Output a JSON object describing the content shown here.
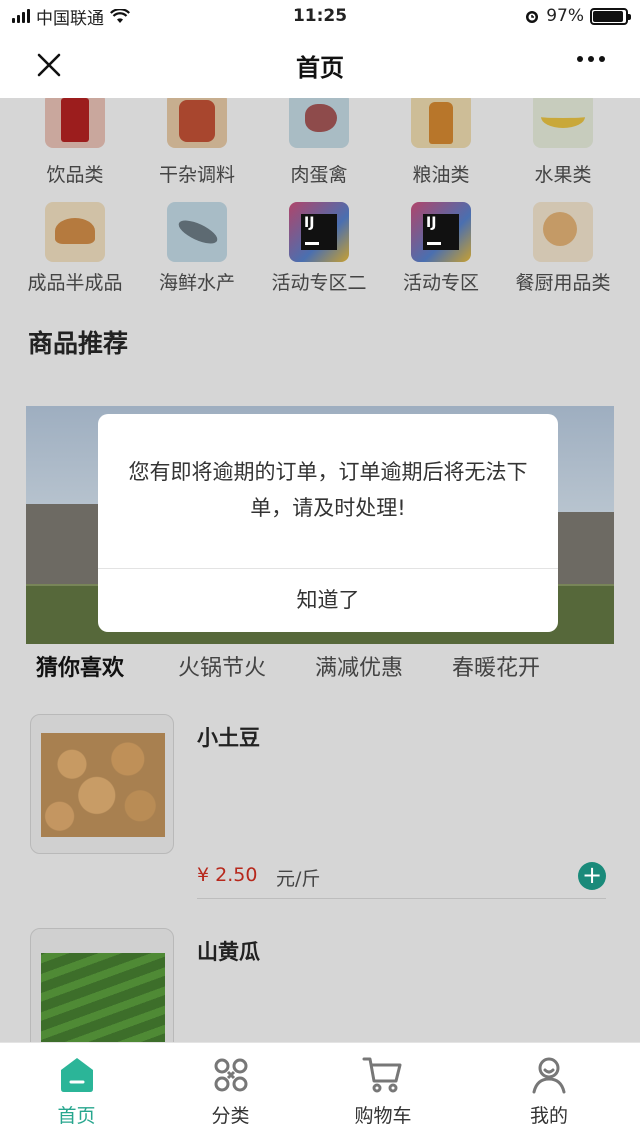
{
  "status_bar": {
    "carrier": "中国联通",
    "time": "11:25",
    "battery": "97%"
  },
  "nav": {
    "title": "首页"
  },
  "categories_row1": [
    {
      "label": "饮品类",
      "icon": "cola-can-icon"
    },
    {
      "label": "干杂调料",
      "icon": "sauce-jar-icon"
    },
    {
      "label": "肉蛋禽",
      "icon": "ham-leg-icon"
    },
    {
      "label": "粮油类",
      "icon": "oil-bottle-icon"
    },
    {
      "label": "水果类",
      "icon": "banana-icon"
    }
  ],
  "categories_row2": [
    {
      "label": "成品半成品",
      "icon": "croissant-icon"
    },
    {
      "label": "海鲜水产",
      "icon": "fish-icon"
    },
    {
      "label": "活动专区二",
      "icon": "ij-logo-icon",
      "badge": "IJ"
    },
    {
      "label": "活动专区",
      "icon": "ij-logo-icon",
      "badge": "IJ"
    },
    {
      "label": "餐厨用品类",
      "icon": "ladle-icon"
    }
  ],
  "recommend": {
    "title": "商品推荐"
  },
  "tabs": [
    "猜你喜欢",
    "火锅节火",
    "满减优惠",
    "春暖花开"
  ],
  "products": [
    {
      "name": "小土豆",
      "price": "¥ 2.50",
      "unit": "元/斤"
    },
    {
      "name": "山黄瓜"
    }
  ],
  "modal": {
    "message": "您有即将逾期的订单，订单逾期后将无法下单，请及时处理!",
    "button": "知道了"
  },
  "tab_bar": [
    {
      "label": "首页",
      "icon": "home-icon",
      "active": true
    },
    {
      "label": "分类",
      "icon": "category-icon"
    },
    {
      "label": "购物车",
      "icon": "cart-icon"
    },
    {
      "label": "我的",
      "icon": "profile-icon"
    }
  ],
  "colors": {
    "accent": "#27a68e",
    "price": "#b7281c",
    "add_button": "#1a8a7a"
  }
}
